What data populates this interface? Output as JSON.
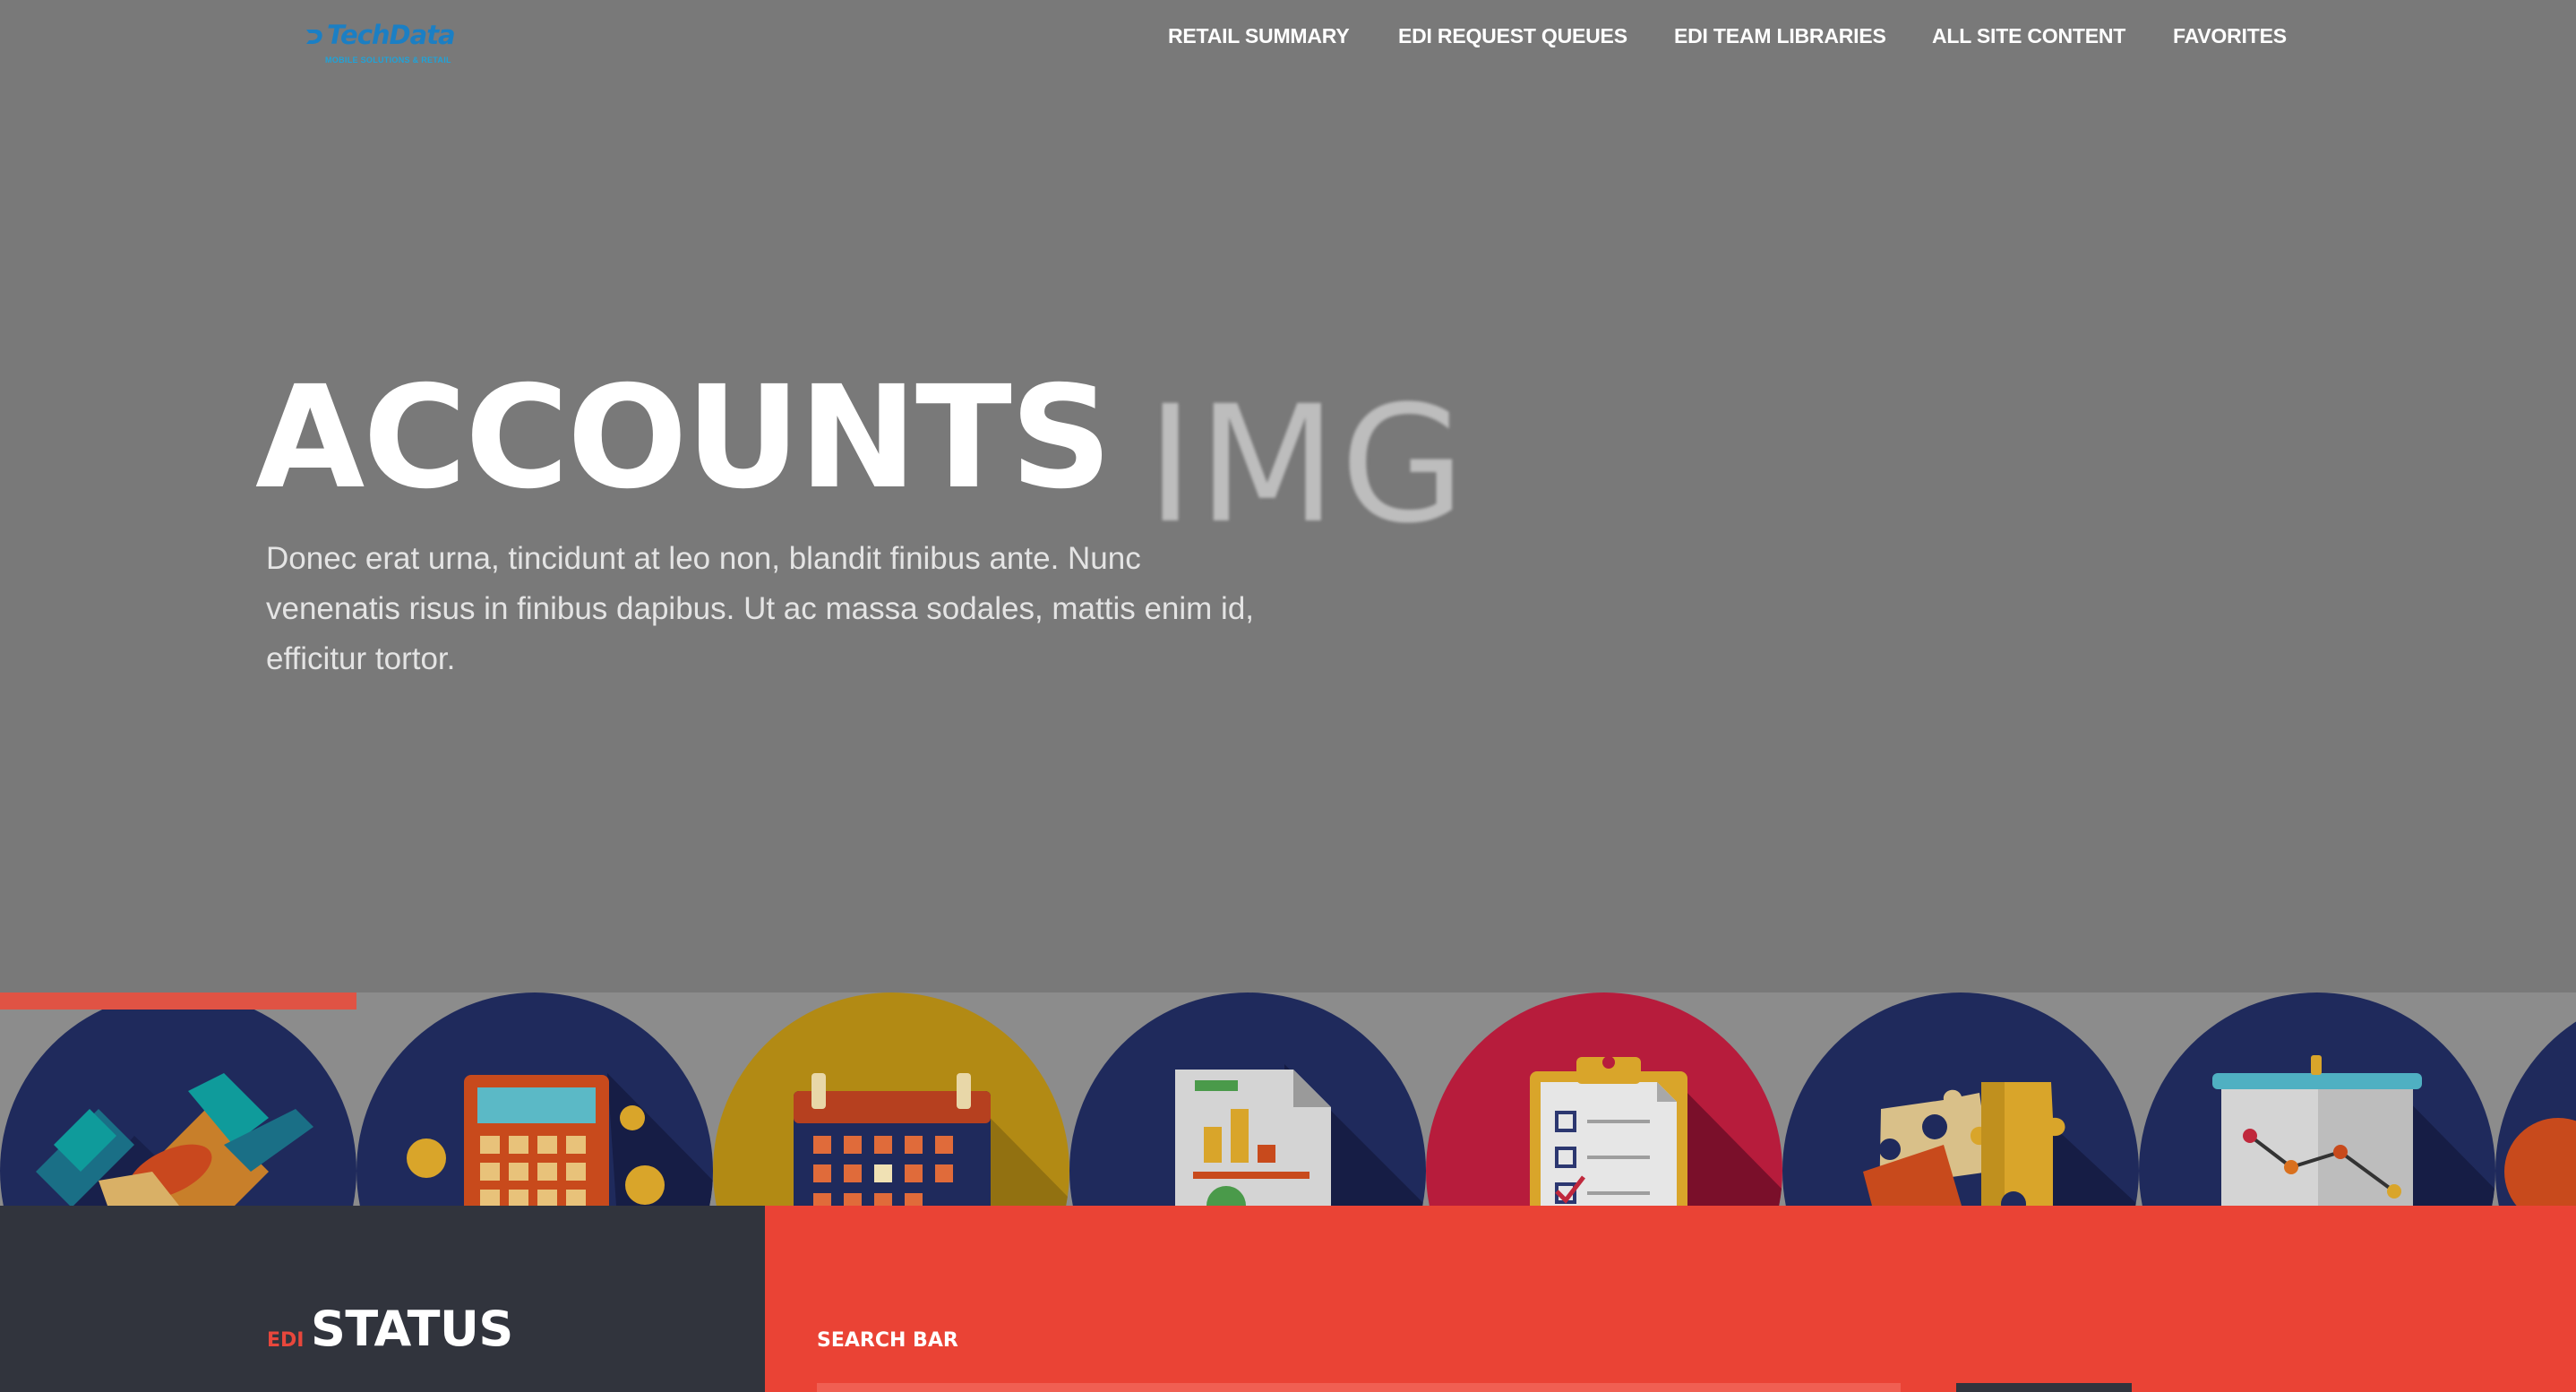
{
  "brand": {
    "name": "TechData",
    "tagline": "MOBILE SOLUTIONS & RETAIL",
    "color": "#1b7fc4"
  },
  "nav": {
    "items": [
      {
        "label": "RETAIL SUMMARY"
      },
      {
        "label": "EDI REQUEST QUEUES"
      },
      {
        "label": "EDI TEAM LIBRARIES"
      },
      {
        "label": "ALL SITE CONTENT"
      },
      {
        "label": "FAVORITES"
      }
    ]
  },
  "hero": {
    "title": "ACCOUNTS",
    "image_placeholder": "IMG",
    "description": "Donec erat urna, tincidunt at leo non, blandit finibus ante. Nunc venenatis risus in finibus dapibus. Ut ac massa sodales, mattis enim id, efficitur tortor."
  },
  "icon_strip": {
    "active_index": 0,
    "accent_color": "#e05344",
    "icons": [
      {
        "icon": "handshake-icon",
        "color": "#1f2a5c"
      },
      {
        "icon": "calculator-icon",
        "color": "#1f2a5c"
      },
      {
        "icon": "calendar-icon",
        "color": "#b28a14"
      },
      {
        "icon": "report-chart-icon",
        "color": "#1f2a5c"
      },
      {
        "icon": "checklist-clipboard-icon",
        "color": "#b71c3c"
      },
      {
        "icon": "puzzle-icon",
        "color": "#1f2a5c"
      },
      {
        "icon": "presentation-board-icon",
        "color": "#1f2a5c"
      },
      {
        "icon": "partial-icon",
        "color": "#1f2a5c"
      }
    ]
  },
  "status": {
    "prefix": "EDI",
    "title": "STATUS"
  },
  "search": {
    "label": "SEARCH BAR",
    "placeholder": ""
  },
  "colors": {
    "hero_bg": "#797979",
    "status_bg": "#31343d",
    "search_bg": "#ea4335"
  }
}
